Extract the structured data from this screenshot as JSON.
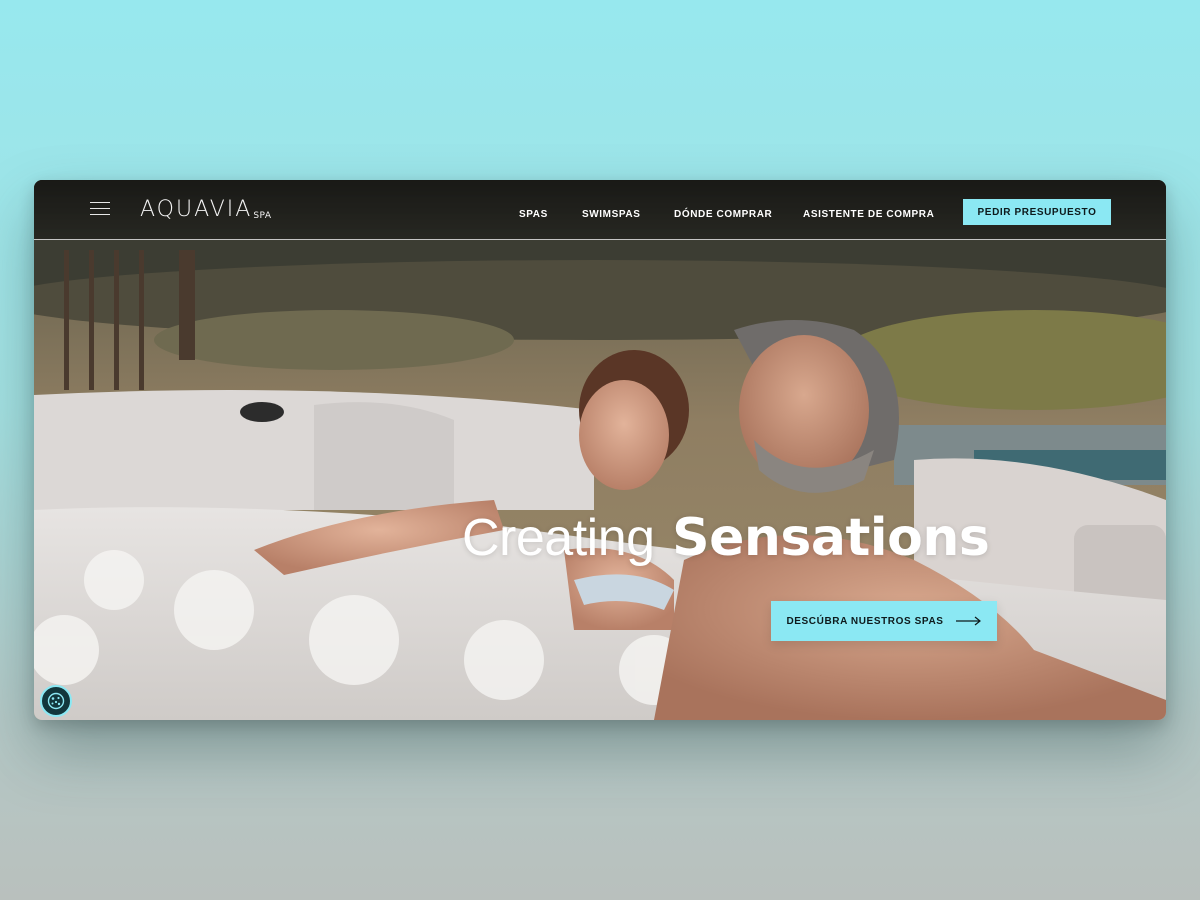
{
  "brand": {
    "name": "AQUAVIA",
    "suffix": "SPA"
  },
  "nav": {
    "items": [
      {
        "label": "SPAS"
      },
      {
        "label": "SWIMSPAS"
      },
      {
        "label": "DÓNDE COMPRAR"
      },
      {
        "label": "ASISTENTE DE COMPRA"
      }
    ],
    "cta_label": "PEDIR PRESUPUESTO"
  },
  "hero": {
    "headline_light": "Creating",
    "headline_bold": "Sensations",
    "cta_label": "DESCÚBRA NUESTROS SPAS"
  },
  "icons": {
    "menu": "hamburger-menu-icon",
    "arrow": "arrow-right-icon",
    "cookie": "cookie-settings-icon"
  },
  "colors": {
    "accent": "#8be8f3",
    "topbar": "#1e1e1a",
    "page_background": "#97e8ee"
  }
}
